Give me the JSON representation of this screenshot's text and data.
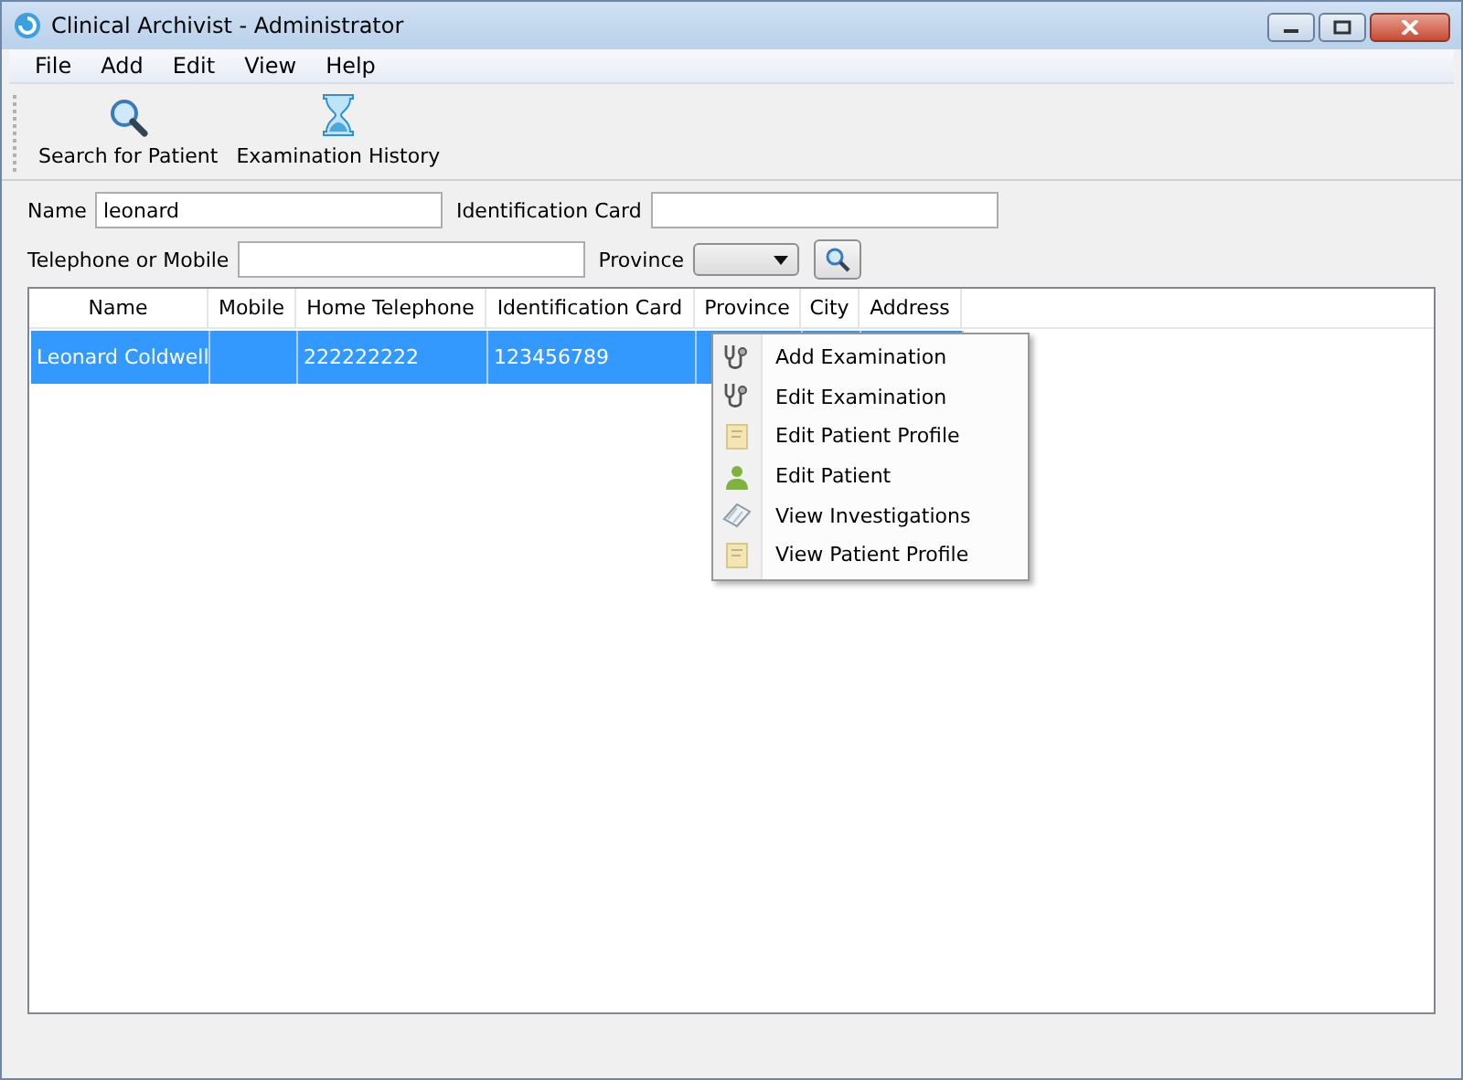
{
  "window": {
    "title": "Clinical Archivist - Administrator"
  },
  "menu_bar": [
    "File",
    "Add",
    "Edit",
    "View",
    "Help"
  ],
  "toolbar": [
    {
      "label": "Search for Patient",
      "kind": "search"
    },
    {
      "label": "Examination History",
      "kind": "hourglass"
    }
  ],
  "search_form": {
    "name_label": "Name",
    "name_value": "leonard",
    "id_label": "Identification Card",
    "phone_label": "Telephone or Mobile",
    "province_label": "Province"
  },
  "table": {
    "columns": [
      "Name",
      "Mobile",
      "Home Telephone",
      "Identification Card",
      "Province",
      "City",
      "Address"
    ],
    "rows": [
      {
        "selected": true,
        "cells": [
          "Leonard Coldwell",
          "",
          "222222222",
          "123456789",
          "",
          "",
          ""
        ]
      }
    ]
  },
  "context_menu": [
    {
      "label": "Add Examination",
      "kind": "stethoscope"
    },
    {
      "label": "Edit Examination",
      "kind": "stethoscope"
    },
    {
      "label": "Edit Patient Profile",
      "kind": "note"
    },
    {
      "label": "Edit Patient",
      "kind": "person"
    },
    {
      "label": "View Investigations",
      "kind": "book"
    },
    {
      "label": "View Patient Profile",
      "kind": "note"
    }
  ]
}
